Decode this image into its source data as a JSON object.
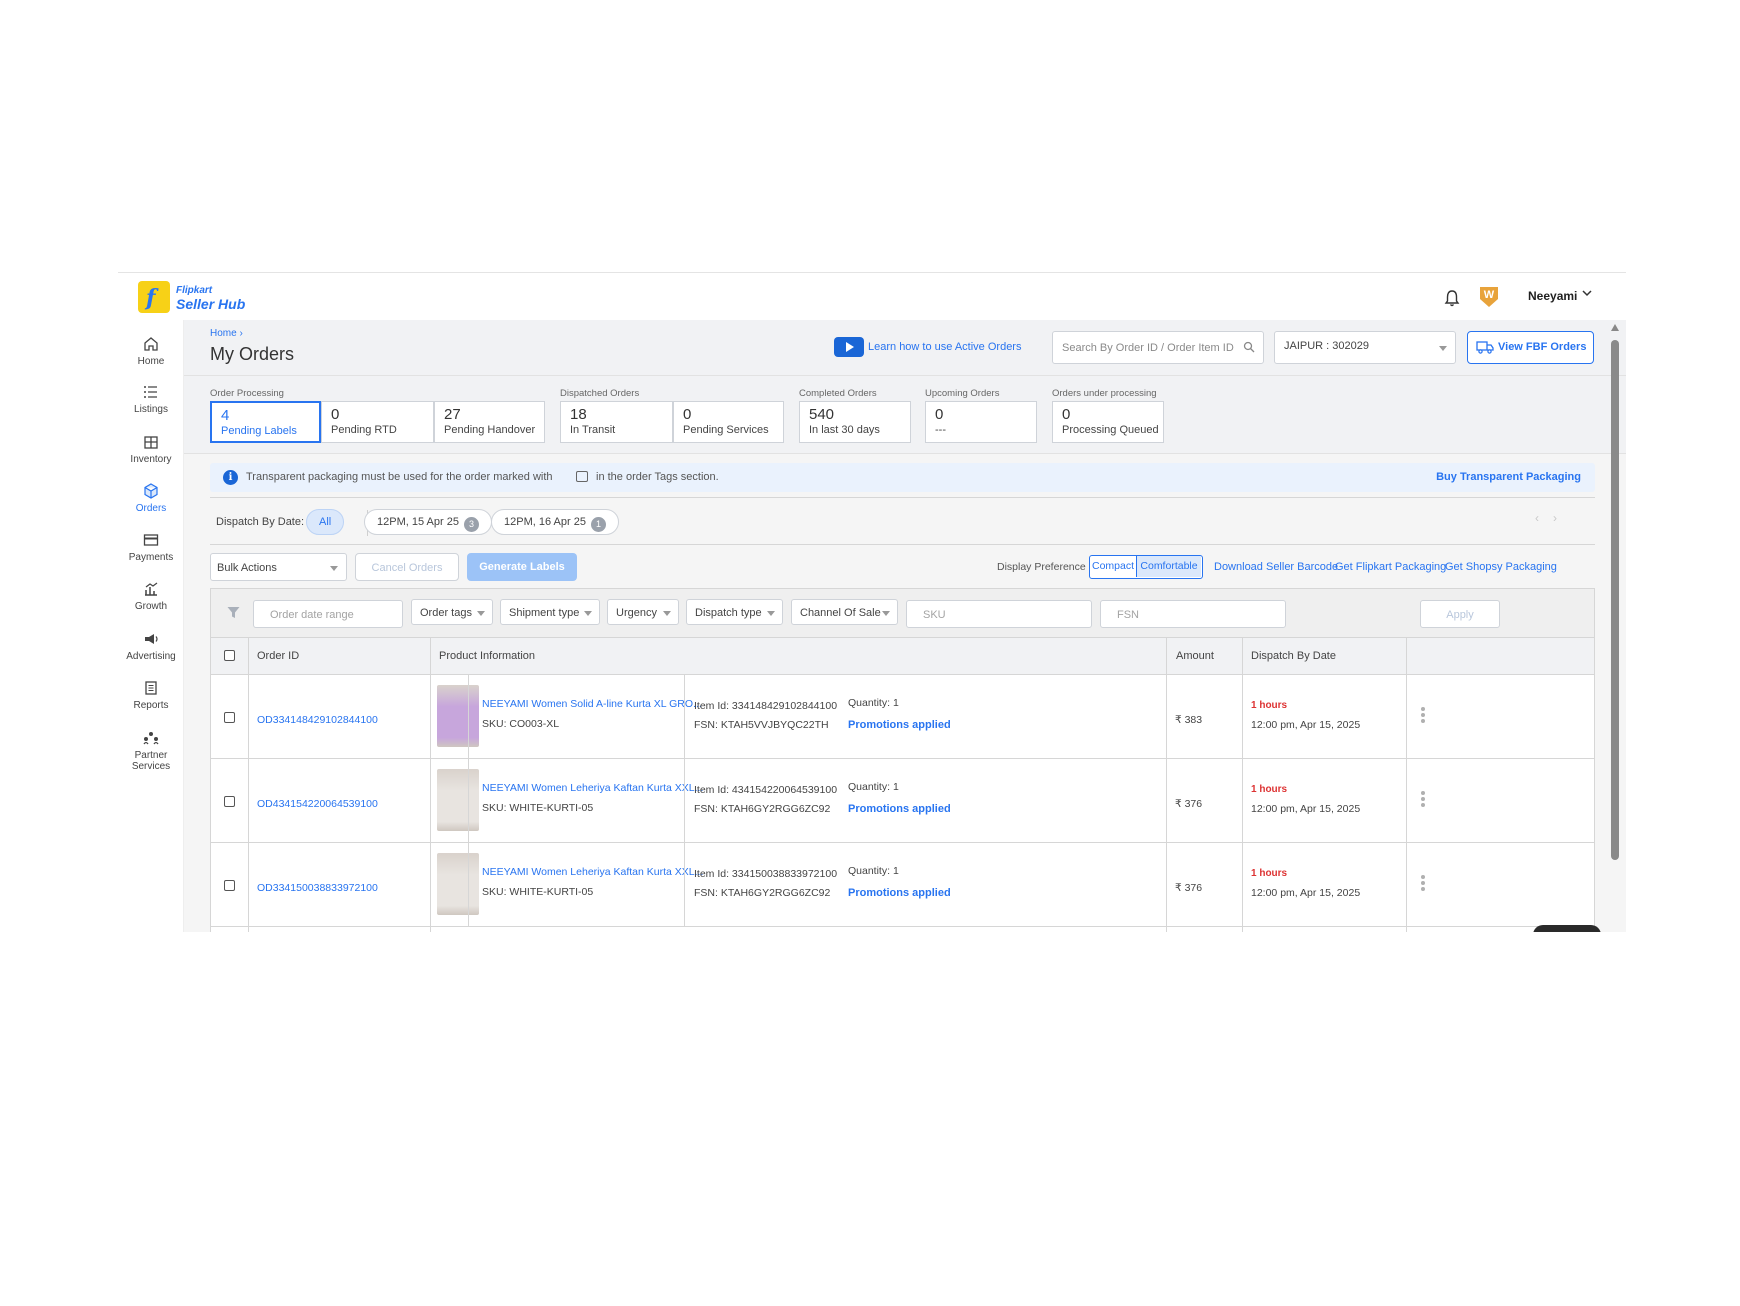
{
  "app": {
    "logo_top": "Flipkart",
    "logo_bottom": "Seller Hub",
    "logo_f": "f",
    "user_name": "Neeyami",
    "badge_letter": "W"
  },
  "sidebar": {
    "items": [
      {
        "label": "Home",
        "icon": "home-icon"
      },
      {
        "label": "Listings",
        "icon": "list-icon"
      },
      {
        "label": "Inventory",
        "icon": "inventory-icon"
      },
      {
        "label": "Orders",
        "icon": "box-icon"
      },
      {
        "label": "Payments",
        "icon": "card-icon"
      },
      {
        "label": "Growth",
        "icon": "growth-icon"
      },
      {
        "label": "Advertising",
        "icon": "megaphone-icon"
      },
      {
        "label": "Reports",
        "icon": "report-icon"
      },
      {
        "label": "Partner",
        "label2": "Services",
        "icon": "partners-icon"
      }
    ]
  },
  "header": {
    "breadcrumb": "Home",
    "title": "My Orders",
    "learn_link": "Learn how to use Active Orders",
    "search_placeholder": "Search By Order ID / Order Item ID",
    "location": "JAIPUR : 302029",
    "fbf_button": "View FBF Orders"
  },
  "summary": {
    "groups": [
      {
        "label": "Order Processing"
      },
      {
        "label": "Dispatched Orders"
      },
      {
        "label": "Completed Orders"
      },
      {
        "label": "Upcoming Orders"
      },
      {
        "label": "Orders under processing"
      }
    ],
    "cards": [
      {
        "num": "4",
        "label": "Pending Labels",
        "selected": true
      },
      {
        "num": "0",
        "label": "Pending RTD"
      },
      {
        "num": "27",
        "label": "Pending Handover"
      },
      {
        "num": "18",
        "label": "In Transit"
      },
      {
        "num": "0",
        "label": "Pending Services"
      },
      {
        "num": "540",
        "label": "In last 30 days"
      },
      {
        "num": "0",
        "label": "---"
      },
      {
        "num": "0",
        "label": "Processing Queued"
      }
    ]
  },
  "banner": {
    "text_before": "Transparent packaging must be used for the order marked with",
    "text_after": "in the order Tags section.",
    "action": "Buy Transparent Packaging"
  },
  "dispatch": {
    "label": "Dispatch By Date:",
    "chips": [
      {
        "label": "All",
        "active": true
      },
      {
        "label": "12PM, 15 Apr 25",
        "count": "3"
      },
      {
        "label": "12PM, 16 Apr 25",
        "count": "1"
      }
    ]
  },
  "actions": {
    "bulk": "Bulk Actions",
    "cancel": "Cancel Orders",
    "generate": "Generate Labels",
    "pref_label": "Display Preference",
    "pref_compact": "Compact",
    "pref_comfortable": "Comfortable",
    "links": [
      "Download Seller Barcode",
      "Get Flipkart Packaging",
      "Get Shopsy Packaging"
    ]
  },
  "filters": {
    "date_placeholder": "Order date range",
    "selects": [
      "Order tags",
      "Shipment type",
      "Urgency",
      "Dispatch type",
      "Channel Of Sale"
    ],
    "sku_placeholder": "SKU",
    "fsn_placeholder": "FSN",
    "apply": "Apply"
  },
  "table": {
    "headers": [
      "Order ID",
      "Product Information",
      "Amount",
      "Dispatch By Date"
    ],
    "rows": [
      {
        "order_id": "OD334148429102844100",
        "product": "NEEYAMI Women Solid A-line Kurta XL GRO...",
        "sku": "SKU:  CO003-XL",
        "item_id": "Item Id:  334148429102844100",
        "fsn": "FSN:  KTAH5VVJBYQC22TH",
        "quantity": "Quantity:  1",
        "promo": "Promotions applied",
        "amount": "₹ 383",
        "hours": "1 hours",
        "dispatch": "12:00 pm, Apr 15, 2025",
        "thumb_color": "#c7a6dc"
      },
      {
        "order_id": "OD434154220064539100",
        "product": "NEEYAMI Women Leheriya Kaftan Kurta XXL...",
        "sku": "SKU:  WHITE-KURTI-05",
        "item_id": "Item Id:  434154220064539100",
        "fsn": "FSN:  KTAH6GY2RGG6ZC92",
        "quantity": "Quantity:  1",
        "promo": "Promotions applied",
        "amount": "₹ 376",
        "hours": "1 hours",
        "dispatch": "12:00 pm, Apr 15, 2025",
        "thumb_color": "#e8e4e0"
      },
      {
        "order_id": "OD334150038833972100",
        "product": "NEEYAMI Women Leheriya Kaftan Kurta XXL...",
        "sku": "SKU:  WHITE-KURTI-05",
        "item_id": "Item Id:  334150038833972100",
        "fsn": "FSN:  KTAH6GY2RGG6ZC92",
        "quantity": "Quantity:  1",
        "promo": "Promotions applied",
        "amount": "₹ 376",
        "hours": "1 hours",
        "dispatch": "12:00 pm, Apr 15, 2025",
        "thumb_color": "#e8e4e0"
      }
    ]
  },
  "colors": {
    "accent": "#2874f0",
    "urgent": "#dd3333",
    "brand_yellow": "#f7d117"
  }
}
